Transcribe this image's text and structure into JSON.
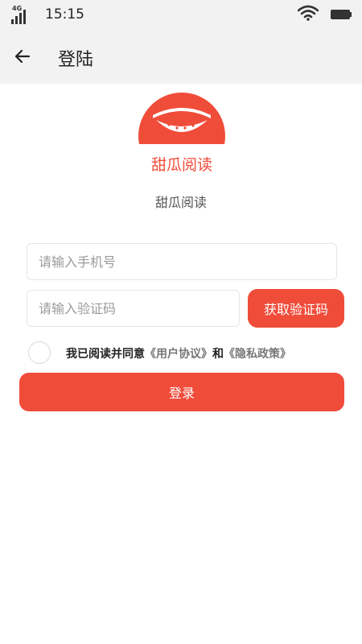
{
  "status_bar": {
    "network": "4G",
    "time": "15:15"
  },
  "app_bar": {
    "title": "登陆"
  },
  "logo": {
    "text": "甜瓜阅读",
    "color": "#f04c3a"
  },
  "app_name": "甜瓜阅读",
  "form": {
    "phone_placeholder": "请输入手机号",
    "phone_value": "",
    "code_placeholder": "请输入验证码",
    "code_value": "",
    "get_code_label": "获取验证码",
    "agreement": {
      "checked": false,
      "prefix": "我已阅读并同意",
      "user_agreement": "《用户协议》",
      "conjunction": "和",
      "privacy_policy": "《隐私政策》"
    },
    "login_label": "登录"
  },
  "colors": {
    "accent": "#f04c3a",
    "bar_background": "#f2f2f2"
  }
}
